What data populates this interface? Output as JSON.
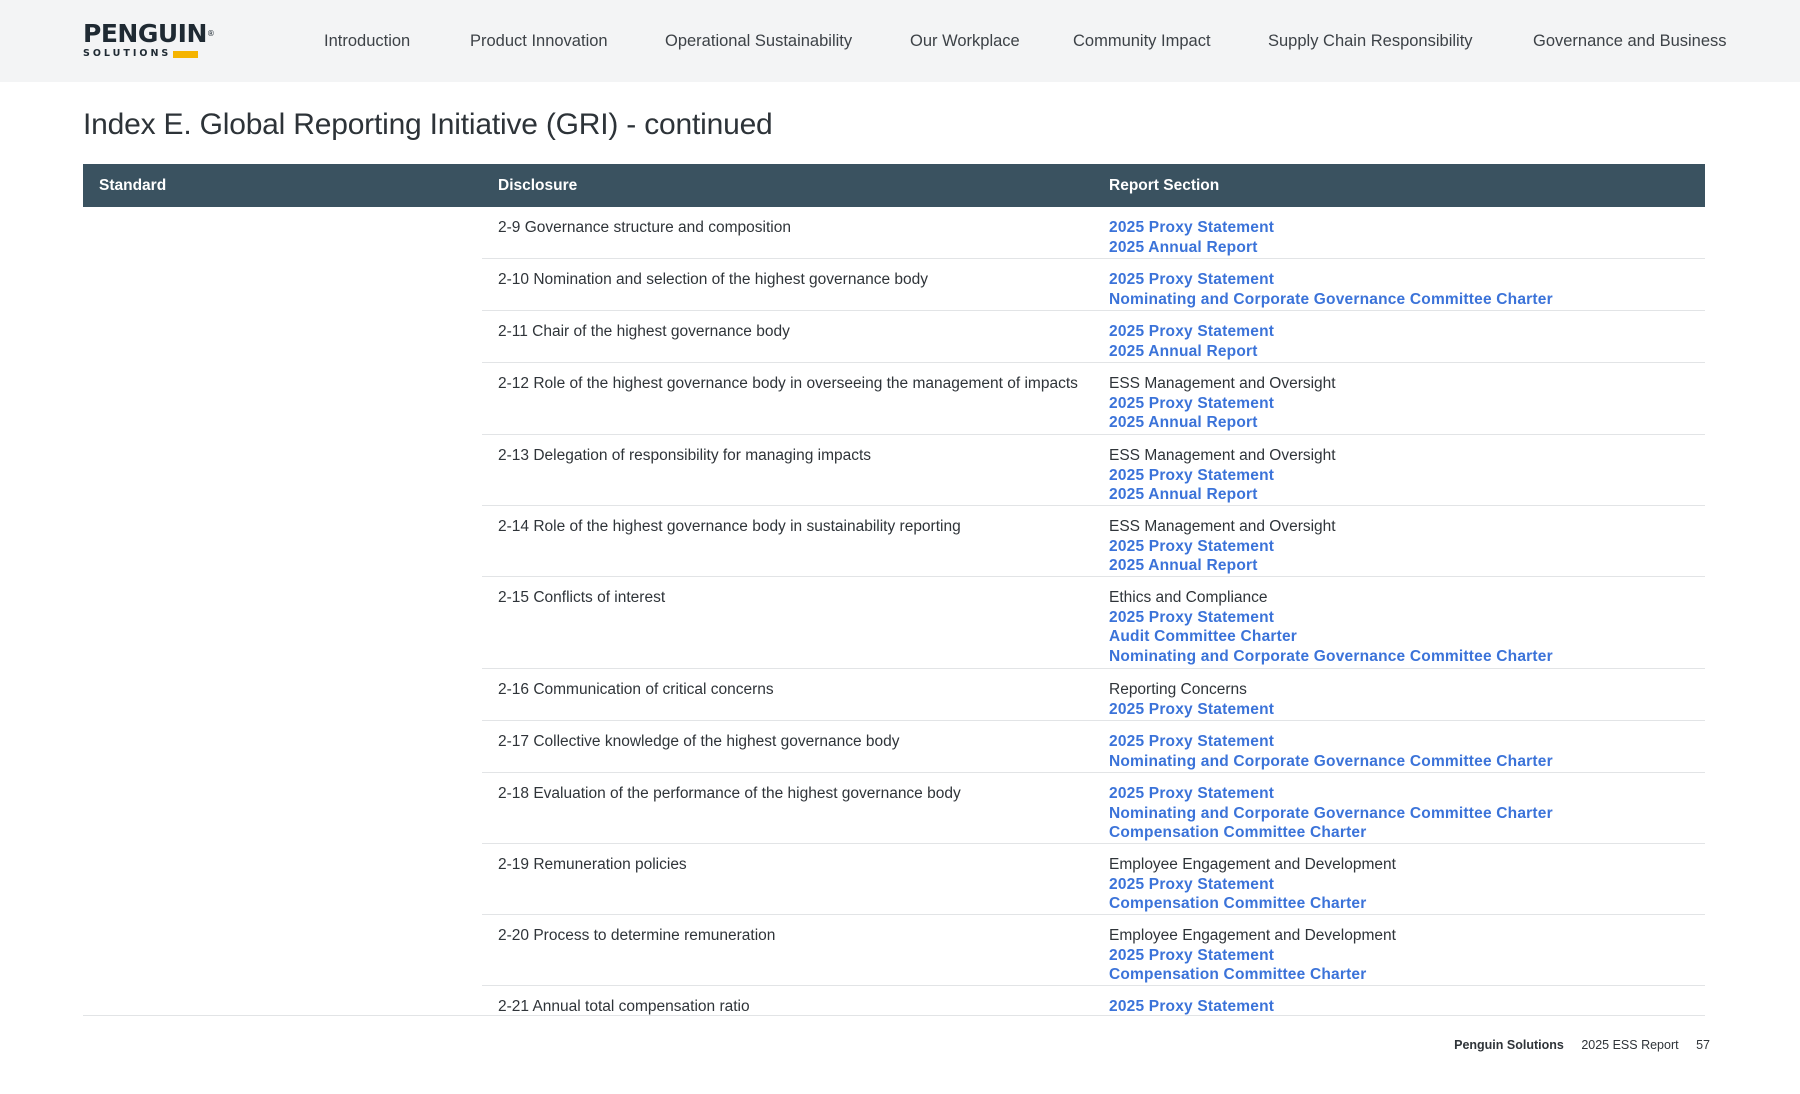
{
  "header": {
    "logo": {
      "wordmark": "PENGUIN",
      "tm": "®",
      "sub": "SOLUTIONS",
      "accent": "#f5b400"
    },
    "nav": [
      {
        "label": "Introduction"
      },
      {
        "label": "Product Innovation"
      },
      {
        "label": "Operational Sustainability"
      },
      {
        "label": "Our Workplace"
      },
      {
        "label": "Community Impact"
      },
      {
        "label": "Supply Chain Responsibility"
      },
      {
        "label": "Governance and Business"
      }
    ]
  },
  "page_title": "Index E. Global Reporting Initiative (GRI) - continued",
  "table": {
    "columns": [
      "Standard",
      "Disclosure",
      "Report Section"
    ],
    "rows": [
      {
        "disclosure": "2-9 Governance structure and composition",
        "refs": [
          {
            "text": "2025 Proxy Statement",
            "link": true
          },
          {
            "text": "2025 Annual Report",
            "link": true
          }
        ]
      },
      {
        "disclosure": "2-10 Nomination and selection of the highest governance body",
        "refs": [
          {
            "text": "2025 Proxy Statement",
            "link": true
          },
          {
            "text": "Nominating and Corporate Governance Committee Charter",
            "link": true
          }
        ]
      },
      {
        "disclosure": "2-11 Chair of the highest governance body",
        "refs": [
          {
            "text": "2025 Proxy Statement",
            "link": true
          },
          {
            "text": "2025 Annual Report",
            "link": true
          }
        ]
      },
      {
        "disclosure": "2-12 Role of the highest governance body in overseeing the management of impacts",
        "refs": [
          {
            "text": "ESS Management and Oversight",
            "link": false
          },
          {
            "text": "2025 Proxy Statement",
            "link": true
          },
          {
            "text": "2025 Annual Report",
            "link": true
          }
        ]
      },
      {
        "disclosure": "2-13 Delegation of responsibility for managing impacts",
        "refs": [
          {
            "text": "ESS Management and Oversight",
            "link": false
          },
          {
            "text": "2025 Proxy Statement",
            "link": true
          },
          {
            "text": "2025 Annual Report",
            "link": true
          }
        ]
      },
      {
        "disclosure": "2-14 Role of the highest governance body in sustainability reporting",
        "refs": [
          {
            "text": "ESS Management and Oversight",
            "link": false
          },
          {
            "text": "2025 Proxy Statement",
            "link": true
          },
          {
            "text": "2025 Annual Report",
            "link": true
          }
        ]
      },
      {
        "disclosure": "2-15 Conflicts of interest",
        "refs": [
          {
            "text": "Ethics and Compliance",
            "link": false
          },
          {
            "text": "2025 Proxy Statement",
            "link": true
          },
          {
            "text": "Audit Committee Charter",
            "link": true
          },
          {
            "text": "Nominating and Corporate Governance Committee Charter",
            "link": true
          }
        ]
      },
      {
        "disclosure": "2-16 Communication of critical concerns",
        "refs": [
          {
            "text": "Reporting Concerns",
            "link": false
          },
          {
            "text": "2025 Proxy Statement",
            "link": true
          }
        ]
      },
      {
        "disclosure": "2-17 Collective knowledge of the highest governance body",
        "refs": [
          {
            "text": "2025 Proxy Statement",
            "link": true
          },
          {
            "text": "Nominating and Corporate Governance Committee Charter",
            "link": true
          }
        ]
      },
      {
        "disclosure": "2-18 Evaluation of the performance of the highest governance body",
        "refs": [
          {
            "text": "2025 Proxy Statement",
            "link": true
          },
          {
            "text": "Nominating and Corporate Governance Committee Charter",
            "link": true
          },
          {
            "text": "Compensation Committee Charter",
            "link": true
          }
        ]
      },
      {
        "disclosure": "2-19 Remuneration policies",
        "refs": [
          {
            "text": "Employee Engagement and Development",
            "link": false
          },
          {
            "text": "2025 Proxy Statement",
            "link": true
          },
          {
            "text": "Compensation Committee Charter",
            "link": true
          }
        ]
      },
      {
        "disclosure": "2-20 Process to determine remuneration",
        "refs": [
          {
            "text": "Employee Engagement and Development",
            "link": false
          },
          {
            "text": "2025 Proxy Statement",
            "link": true
          },
          {
            "text": "Compensation Committee Charter",
            "link": true
          }
        ]
      },
      {
        "disclosure": "2-21 Annual total compensation ratio",
        "refs": [
          {
            "text": "2025 Proxy Statement",
            "link": true
          }
        ]
      }
    ]
  },
  "footer": {
    "brand": "Penguin Solutions",
    "report": "2025 ESS Report",
    "page": "57"
  },
  "colors": {
    "header_bg": "#3a5260",
    "link": "#3b73d9",
    "topbar_bg": "#f3f4f5"
  }
}
